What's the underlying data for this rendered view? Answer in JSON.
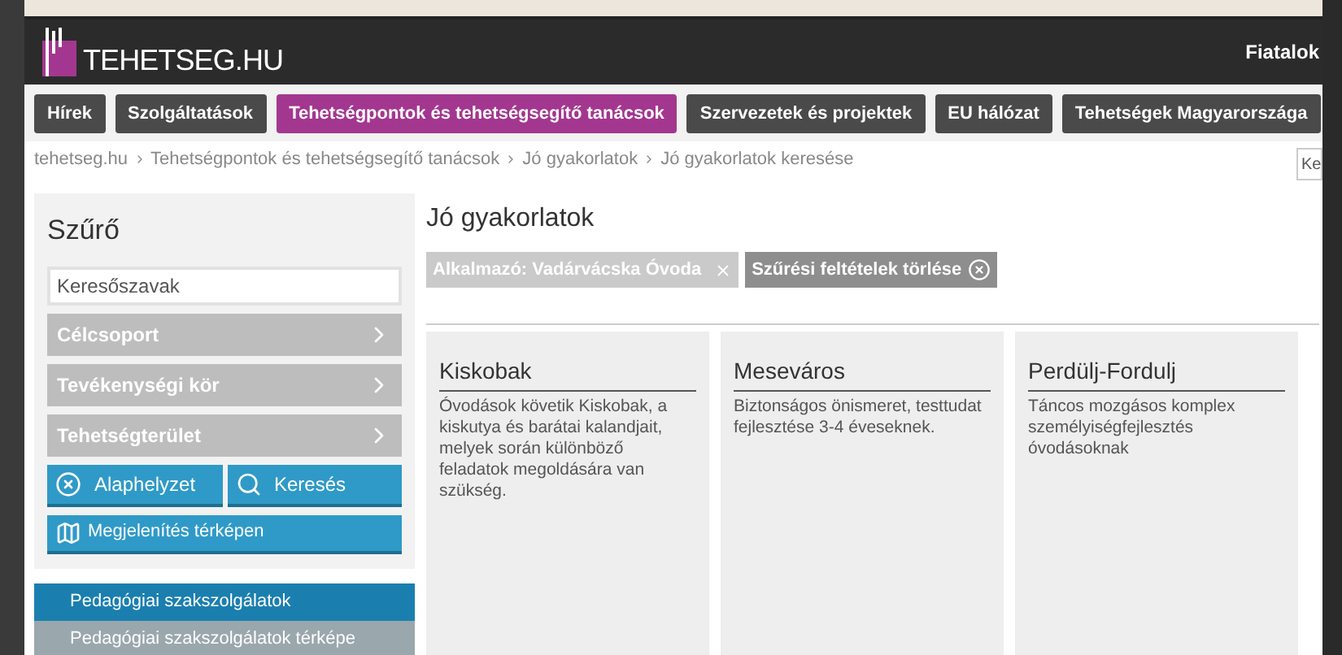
{
  "header": {
    "logo": "TEHETSEG.HU",
    "user_link": "Fiatalok"
  },
  "nav": [
    {
      "label": "Hírek",
      "selected": false
    },
    {
      "label": "Szolgáltatások",
      "selected": false
    },
    {
      "label": "Tehetségpontok és tehetségsegítő tanácsok",
      "selected": true
    },
    {
      "label": "Szervezetek és projektek",
      "selected": false
    },
    {
      "label": "EU hálózat",
      "selected": false
    },
    {
      "label": "Tehetségek Magyarországa",
      "selected": false
    }
  ],
  "breadcrumb": [
    "tehetseg.hu",
    "Tehetségpontok és tehetségsegítő tanácsok",
    "Jó gyakorlatok",
    "Jó gyakorlatok keresése"
  ],
  "search": {
    "placeholder": "Ke"
  },
  "filter": {
    "title": "Szűrő",
    "keyword_placeholder": "Keresőszavak",
    "dropdowns": [
      "Célcsoport",
      "Tevékenységi kör",
      "Tehetségterület"
    ],
    "reset_button": "Alaphelyzet",
    "search_button": "Keresés",
    "map_button": "Megjelenítés térképen"
  },
  "side_menu": [
    {
      "label": "Pedagógiai szakszolgálatok",
      "selected": true
    },
    {
      "label": "Pedagógiai szakszolgálatok térképe",
      "selected": false
    }
  ],
  "main": {
    "title": "Jó gyakorlatok",
    "active_filter": "Alkalmazó: Vadárvácska Óvoda",
    "clear_filters": "Szűrési feltételek törlése",
    "cards": [
      {
        "title": "Kiskobak",
        "text": "Óvodások követik Kiskobak, a kiskutya és barátai kalandjait, melyek során különböző feladatok megoldására van szükség."
      },
      {
        "title": "Meseváros",
        "text": "Biztonságos önismeret, testtudat fejlesztése 3-4 éveseknek."
      },
      {
        "title": "Perdülj-Fordulj",
        "text": "Táncos mozgásos komplex személyiségfejlesztés óvodásoknak"
      }
    ]
  }
}
